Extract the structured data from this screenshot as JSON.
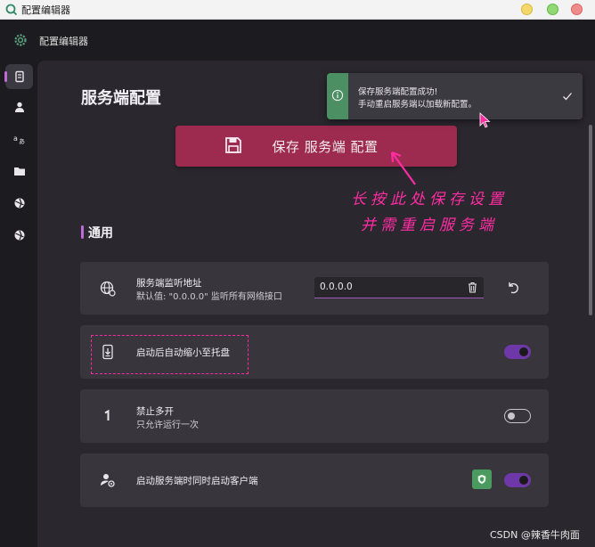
{
  "window": {
    "title": "配置编辑器"
  },
  "app": {
    "title": "配置编辑器"
  },
  "page": {
    "title": "服务端配置"
  },
  "save_button": {
    "label": "保存 服务端 配置"
  },
  "annotation": {
    "line1": "长按此处保存设置",
    "line2": "并需重启服务端"
  },
  "section": {
    "title": "通用"
  },
  "settings": [
    {
      "title": "服务端监听地址",
      "subtitle": "默认值: \"0.0.0.0\" 监听所有网络接口",
      "value": "0.0.0.0",
      "control": "input",
      "icon": "globe-settings-icon"
    },
    {
      "title": "启动后自动缩小至托盘",
      "subtitle": "",
      "control": "toggle",
      "state": "on",
      "icon": "phone-download-icon"
    },
    {
      "title": "禁止多开",
      "subtitle": "只允许运行一次",
      "control": "toggle",
      "state": "off",
      "icon": "number-one-icon"
    },
    {
      "title": "启动服务端时同时启动客户端",
      "subtitle": "",
      "control": "toggle",
      "state": "on",
      "icon": "user-settings-icon"
    }
  ],
  "toast": {
    "line1": "保存服务端配置成功!",
    "line2": "手动重启服务端以加载新配置。",
    "accent": "#4b8f63"
  },
  "watermark": {
    "text": "CSDN @辣香牛肉面"
  },
  "colors": {
    "accent": "#c06ad8",
    "save_button": "#9d2b4f",
    "annotation": "#ff2ca3",
    "toggle_on": "#6f38a8"
  }
}
